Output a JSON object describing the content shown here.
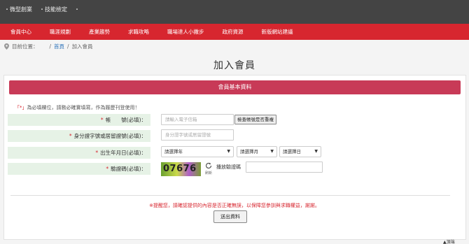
{
  "topbar": {
    "links": [
      "・微型創業",
      "・技能檢定",
      "・"
    ]
  },
  "nav": {
    "items": [
      "會員中心",
      "職涯規劃",
      "產業趨勢",
      "求職攻略",
      "職場達人小撇步",
      "政府資源",
      "新版網站建議"
    ]
  },
  "breadcrumb": {
    "label": "目前位置：",
    "sep": "/",
    "home": "首頁",
    "current": "加入會員"
  },
  "page": {
    "title": "加入會員"
  },
  "panel": {
    "header": "會員基本資料",
    "notice_mark": "「*」",
    "notice_text": "為必填欄位，請務必確實填寫，作為履歷刊登使用！",
    "fields": {
      "account": {
        "required": "*",
        "label": "帳　　號(必填)：",
        "placeholder": "請輸入電子信箱",
        "button": "檢查帳號是否重複"
      },
      "id": {
        "required": "*",
        "label": "身分證字號或居留證號(必填)：",
        "placeholder": "身分證字號或居留證號"
      },
      "birth": {
        "required": "*",
        "label": "出生年月日(必填)：",
        "year": "請選擇年",
        "month": "請選擇月",
        "day": "請選擇日"
      },
      "captcha": {
        "required": "*",
        "label": "驗證碼(必填)：",
        "code": "07676",
        "refresh": "刷新",
        "play": "播放驗證碼"
      }
    },
    "warning": "※提醒您，請確認提供的內容是否正確無誤，以保障您參訓與求職權益，謝謝。",
    "submit": "送出資料"
  },
  "footnote": "▲頂端"
}
